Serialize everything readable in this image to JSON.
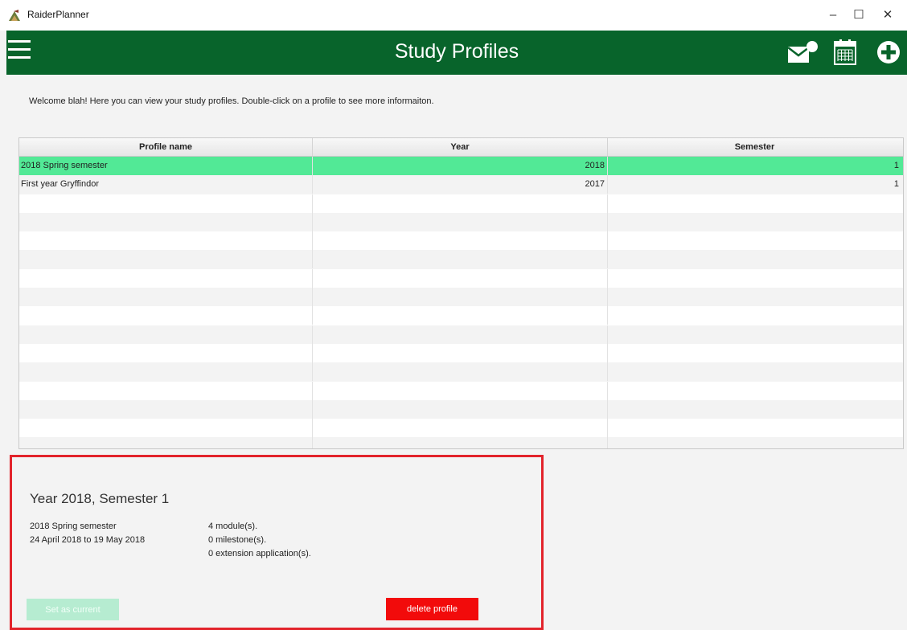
{
  "window": {
    "title": "RaiderPlanner",
    "minimize": "–",
    "maximize": "☐",
    "close": "✕",
    "icon": "app-logo-icon"
  },
  "header": {
    "title": "Study Profiles",
    "background": "#08642b",
    "icons": [
      "menu-icon",
      "mail-icon",
      "calendar-icon",
      "add-icon"
    ]
  },
  "welcome": "Welcome blah! Here you can view your study profiles. Double-click on a profile to see more informaiton.",
  "table": {
    "columns": [
      "Profile name",
      "Year",
      "Semester"
    ],
    "rows": [
      {
        "name": "2018 Spring semester",
        "year": "2018",
        "semester": "1"
      },
      {
        "name": "First year Gryffindor",
        "year": "2017",
        "semester": "1"
      }
    ],
    "selected_color": "#52e996"
  },
  "details": {
    "title": "Year 2018, Semester 1",
    "profile_name": "2018 Spring semester",
    "date_range": "24 April 2018 to 19 May 2018",
    "modules": "4 module(s).",
    "milestones": "0 milestone(s).",
    "extensions": "0 extension application(s).",
    "set_current_label": "Set as current",
    "delete_label": "delete profile",
    "border_color": "#e2232b"
  }
}
